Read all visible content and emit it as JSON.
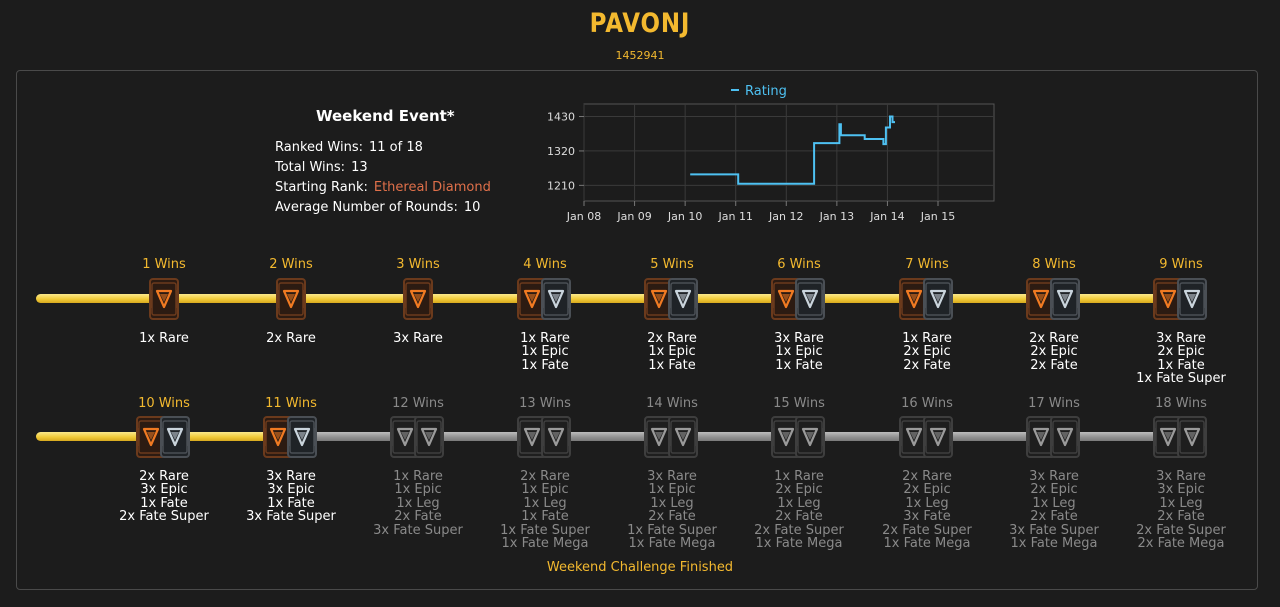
{
  "header": {
    "player_name": "PAVONJ",
    "player_id": "1452941"
  },
  "event": {
    "title": "Weekend Event*",
    "stats": [
      {
        "label": "Ranked Wins:",
        "value": "11 of 18"
      },
      {
        "label": "Total Wins:",
        "value": "13"
      },
      {
        "label": "Starting Rank:",
        "value": "Ethereal Diamond"
      },
      {
        "label": "Average Number of Rounds:",
        "value": "10"
      }
    ]
  },
  "colors": {
    "gold": "#f3b92f",
    "rank": "#e0704a",
    "line": "#4ec1f2",
    "muted": "#8a8a8a"
  },
  "chart_data": {
    "type": "line",
    "title": "",
    "legend": [
      "Rating"
    ],
    "legend_position": "top-center",
    "xlabel": "",
    "ylabel": "",
    "x_ticks": [
      "Jan 08",
      "Jan 09",
      "Jan 10",
      "Jan 11",
      "Jan 12",
      "Jan 13",
      "Jan 14",
      "Jan 15"
    ],
    "y_ticks": [
      1210,
      1320,
      1430
    ],
    "x_range": [
      0,
      7
    ],
    "y_range": [
      1160,
      1470
    ],
    "grid": true,
    "series": [
      {
        "name": "Rating",
        "step": true,
        "points": [
          [
            2.1,
            1245
          ],
          [
            3.05,
            1245
          ],
          [
            3.05,
            1215
          ],
          [
            4.55,
            1215
          ],
          [
            4.55,
            1345
          ],
          [
            5.05,
            1345
          ],
          [
            5.05,
            1405
          ],
          [
            5.08,
            1405
          ],
          [
            5.08,
            1370
          ],
          [
            5.55,
            1370
          ],
          [
            5.55,
            1358
          ],
          [
            5.92,
            1358
          ],
          [
            5.92,
            1342
          ],
          [
            5.97,
            1342
          ],
          [
            5.97,
            1395
          ],
          [
            6.05,
            1395
          ],
          [
            6.05,
            1430
          ],
          [
            6.1,
            1430
          ],
          [
            6.1,
            1412
          ],
          [
            6.15,
            1412
          ]
        ]
      }
    ]
  },
  "tiers": [
    {
      "label": "1 Wins",
      "unlocked": true,
      "crate": "rare",
      "rewards": [
        "1x Rare"
      ]
    },
    {
      "label": "2 Wins",
      "unlocked": true,
      "crate": "rare",
      "rewards": [
        "2x Rare"
      ]
    },
    {
      "label": "3 Wins",
      "unlocked": true,
      "crate": "rare",
      "rewards": [
        "3x Rare"
      ]
    },
    {
      "label": "4 Wins",
      "unlocked": true,
      "crate": "rare-epic",
      "rewards": [
        "1x Rare",
        "1x Epic",
        "1x Fate"
      ]
    },
    {
      "label": "5 Wins",
      "unlocked": true,
      "crate": "rare-epic",
      "rewards": [
        "2x Rare",
        "1x Epic",
        "1x Fate"
      ]
    },
    {
      "label": "6 Wins",
      "unlocked": true,
      "crate": "rare-epic",
      "rewards": [
        "3x Rare",
        "1x Epic",
        "1x Fate"
      ]
    },
    {
      "label": "7 Wins",
      "unlocked": true,
      "crate": "rare-epic",
      "rewards": [
        "1x Rare",
        "2x Epic",
        "2x Fate"
      ]
    },
    {
      "label": "8 Wins",
      "unlocked": true,
      "crate": "rare-epic",
      "rewards": [
        "2x Rare",
        "2x Epic",
        "2x Fate"
      ]
    },
    {
      "label": "9 Wins",
      "unlocked": true,
      "crate": "rare-epic",
      "rewards": [
        "3x Rare",
        "2x Epic",
        "1x Fate",
        "1x Fate Super"
      ]
    },
    {
      "label": "10 Wins",
      "unlocked": true,
      "crate": "rare-epic",
      "rewards": [
        "2x Rare",
        "3x Epic",
        "1x Fate",
        "2x Fate Super"
      ]
    },
    {
      "label": "11 Wins",
      "unlocked": true,
      "crate": "rare-epic",
      "rewards": [
        "3x Rare",
        "3x Epic",
        "1x Fate",
        "3x Fate Super"
      ]
    },
    {
      "label": "12 Wins",
      "unlocked": false,
      "crate": "locked",
      "rewards": [
        "1x Rare",
        "1x Epic",
        "1x Leg",
        "2x Fate",
        "3x Fate Super"
      ]
    },
    {
      "label": "13 Wins",
      "unlocked": false,
      "crate": "locked",
      "rewards": [
        "2x Rare",
        "1x Epic",
        "1x Leg",
        "1x Fate",
        "1x Fate Super",
        "1x Fate Mega"
      ]
    },
    {
      "label": "14 Wins",
      "unlocked": false,
      "crate": "locked",
      "rewards": [
        "3x Rare",
        "1x Epic",
        "1x Leg",
        "2x Fate",
        "1x Fate Super",
        "1x Fate Mega"
      ]
    },
    {
      "label": "15 Wins",
      "unlocked": false,
      "crate": "locked",
      "rewards": [
        "1x Rare",
        "2x Epic",
        "1x Leg",
        "2x Fate",
        "2x Fate Super",
        "1x Fate Mega"
      ]
    },
    {
      "label": "16 Wins",
      "unlocked": false,
      "crate": "locked",
      "rewards": [
        "2x Rare",
        "2x Epic",
        "1x Leg",
        "3x Fate",
        "2x Fate Super",
        "1x Fate Mega"
      ]
    },
    {
      "label": "17 Wins",
      "unlocked": false,
      "crate": "locked",
      "rewards": [
        "3x Rare",
        "2x Epic",
        "1x Leg",
        "2x Fate",
        "3x Fate Super",
        "1x Fate Mega"
      ]
    },
    {
      "label": "18 Wins",
      "unlocked": false,
      "crate": "locked",
      "rewards": [
        "3x Rare",
        "3x Epic",
        "1x Leg",
        "2x Fate",
        "2x Fate Super",
        "2x Fate Mega"
      ]
    }
  ],
  "footer": {
    "status": "Weekend Challenge Finished"
  }
}
